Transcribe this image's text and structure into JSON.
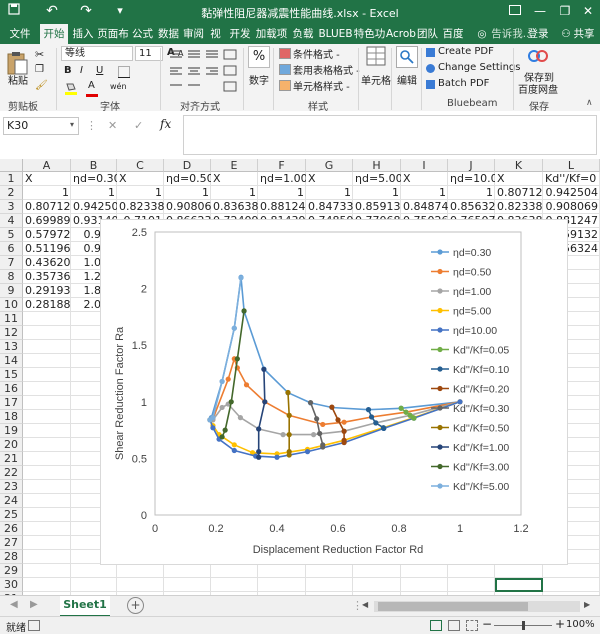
{
  "window": {
    "title": "黏弹性阻尼器减震性能曲线.xlsx - Excel",
    "undo": "↶",
    "redo": "↷",
    "minimize": "—",
    "restore": "❐",
    "close": "✕"
  },
  "tabs": [
    "文件",
    "开始",
    "插入",
    "页面布",
    "公式",
    "数据",
    "审阅",
    "视图",
    "开发工",
    "加载项",
    "负载测",
    "BLUEB",
    "特色功",
    "Acrob",
    "团队",
    "百度网"
  ],
  "tabs_active": "开始",
  "tell_me": "告诉我...",
  "login": "登录",
  "share": "共享",
  "ribbon": {
    "clipboard": {
      "paste": "粘贴",
      "label": "剪贴板"
    },
    "font": {
      "name": "等线",
      "size": "11",
      "label": "字体",
      "bold": "B",
      "italic": "I",
      "underline": "U",
      "grow": "A",
      "shrink": "A",
      "color_a": "A",
      "wen": "wén"
    },
    "align": {
      "label": "对齐方式"
    },
    "number": {
      "label": "数字",
      "pct": "%"
    },
    "styles": {
      "cond": "条件格式 -",
      "table": "套用表格格式 -",
      "cell": "单元格样式 -",
      "label": "样式"
    },
    "cells": {
      "label": "单元格"
    },
    "edit": {
      "label": "编辑"
    },
    "bluebeam": {
      "create": "Create PDF",
      "settings": "Change Settings",
      "batch": "Batch PDF",
      "label": "Bluebeam"
    },
    "save": {
      "line1": "保存到",
      "line2": "百度网盘",
      "label": "保存"
    }
  },
  "formula_bar": {
    "namebox": "K30",
    "fx": "fx",
    "cancel": "✕",
    "enter": "✓",
    "value": ""
  },
  "columns": [
    "A",
    "B",
    "C",
    "D",
    "E",
    "F",
    "G",
    "H",
    "I",
    "J",
    "K",
    "L"
  ],
  "rows": [
    "1",
    "2",
    "3",
    "4",
    "5",
    "6",
    "7",
    "8",
    "9",
    "10",
    "11",
    "12",
    "13",
    "14",
    "15",
    "16",
    "17",
    "18",
    "19",
    "20",
    "21",
    "22",
    "23",
    "24",
    "25",
    "26",
    "27",
    "28",
    "29",
    "30",
    "31"
  ],
  "cells": {
    "r1": [
      "X",
      "ηd=0.30",
      "X",
      "ηd=0.50",
      "X",
      "ηd=1.00",
      "X",
      "ηd=5.00",
      "X",
      "ηd=10.00",
      "X",
      "Kd''/Kf=0"
    ],
    "r2": [
      "1",
      "1",
      "1",
      "1",
      "1",
      "1",
      "1",
      "1",
      "1",
      "1",
      "0.807126",
      "0.942504"
    ],
    "r3": [
      "0.807126",
      "0.942504",
      "0.82338",
      "0.908069",
      "0.836383",
      "0.881247",
      "0.847337",
      "0.859132",
      "0.848742",
      "0.856324",
      "0.82338",
      "0.908069"
    ],
    "r4": [
      "0.699896",
      "0.931406",
      "0.7101",
      "0.866239",
      "0.724093",
      "0.814392",
      "0.74859",
      "0.77068",
      "0.750266",
      "0.765073",
      "0.836383",
      "0.881247"
    ],
    "r5": [
      "0.579725",
      "0.953",
      "",
      "",
      "",
      "",
      "",
      "",
      "",
      "",
      "",
      "0.859132"
    ],
    "r6": [
      "0.511962",
      "0.993",
      "",
      "",
      "",
      "",
      "",
      "",
      "",
      "",
      "",
      "0.856324"
    ],
    "r7": [
      "0.436209",
      "1.082",
      "",
      "",
      "",
      "",
      "",
      "",
      "",
      "",
      "",
      ""
    ],
    "r8": [
      "0.357363",
      "1.287",
      "",
      "",
      "",
      "",
      "",
      "",
      "",
      "",
      "",
      ""
    ],
    "r9": [
      "0.291935",
      "1.803",
      "",
      "",
      "",
      "",
      "",
      "",
      "",
      "",
      "",
      ""
    ],
    "r10": [
      "0.281887",
      "2.095",
      "",
      "",
      "",
      "",
      "",
      "",
      "",
      "",
      "",
      ""
    ]
  },
  "sheet_tab": "Sheet1",
  "add_sheet": "+",
  "status": {
    "ready": "就绪",
    "zoom": "100%",
    "minus": "−",
    "plus": "+"
  },
  "chart_data": {
    "type": "line",
    "xlabel": "Displacement Reduction Factor Rd",
    "ylabel": "Shear Reduction Factor Ra",
    "xlim": [
      0,
      1.2
    ],
    "ylim": [
      0,
      2.5
    ],
    "xticks": [
      "0",
      "0.2",
      "0.4",
      "0.6",
      "0.8",
      "1",
      "1.2"
    ],
    "yticks": [
      "0",
      "0.5",
      "1",
      "1.5",
      "2",
      "2.5"
    ],
    "legend_position": "right",
    "series": [
      {
        "name": "ηd=0.30",
        "color": "#5b9bd5",
        "points": [
          [
            1,
            1
          ],
          [
            0.807,
            0.943
          ],
          [
            0.7,
            0.93
          ],
          [
            0.58,
            0.95
          ],
          [
            0.51,
            0.99
          ],
          [
            0.436,
            1.08
          ],
          [
            0.357,
            1.29
          ],
          [
            0.292,
            1.8
          ],
          [
            0.282,
            2.1
          ],
          [
            0.26,
            1.65
          ],
          [
            0.22,
            1.18
          ],
          [
            0.185,
            0.86
          ]
        ]
      },
      {
        "name": "ηd=0.50",
        "color": "#ed7d31",
        "points": [
          [
            1,
            1
          ],
          [
            0.823,
            0.908
          ],
          [
            0.71,
            0.866
          ],
          [
            0.62,
            0.82
          ],
          [
            0.55,
            0.8
          ],
          [
            0.44,
            0.88
          ],
          [
            0.36,
            1.0
          ],
          [
            0.3,
            1.15
          ],
          [
            0.27,
            1.3
          ],
          [
            0.26,
            1.38
          ],
          [
            0.24,
            1.2
          ],
          [
            0.19,
            0.85
          ]
        ]
      },
      {
        "name": "ηd=1.00",
        "color": "#a5a5a5",
        "points": [
          [
            1,
            1
          ],
          [
            0.836,
            0.881
          ],
          [
            0.724,
            0.814
          ],
          [
            0.62,
            0.74
          ],
          [
            0.52,
            0.71
          ],
          [
            0.42,
            0.71
          ],
          [
            0.34,
            0.76
          ],
          [
            0.28,
            0.86
          ],
          [
            0.24,
            0.98
          ],
          [
            0.22,
            0.95
          ],
          [
            0.19,
            0.84
          ]
        ]
      },
      {
        "name": "ηd=5.00",
        "color": "#ffc000",
        "points": [
          [
            1,
            1
          ],
          [
            0.847,
            0.859
          ],
          [
            0.749,
            0.771
          ],
          [
            0.62,
            0.66
          ],
          [
            0.5,
            0.58
          ],
          [
            0.4,
            0.54
          ],
          [
            0.32,
            0.55
          ],
          [
            0.26,
            0.62
          ],
          [
            0.21,
            0.71
          ],
          [
            0.19,
            0.79
          ],
          [
            0.18,
            0.84
          ]
        ]
      },
      {
        "name": "ηd=10.00",
        "color": "#4472c4",
        "points": [
          [
            1,
            1
          ],
          [
            0.849,
            0.856
          ],
          [
            0.75,
            0.765
          ],
          [
            0.62,
            0.64
          ],
          [
            0.5,
            0.56
          ],
          [
            0.4,
            0.51
          ],
          [
            0.33,
            0.52
          ],
          [
            0.26,
            0.57
          ],
          [
            0.21,
            0.67
          ],
          [
            0.19,
            0.77
          ],
          [
            0.18,
            0.84
          ]
        ]
      },
      {
        "name": "Kd''/Kf=0.05",
        "color": "#70ad47",
        "points": [
          [
            0.807,
            0.943
          ],
          [
            0.823,
            0.908
          ],
          [
            0.836,
            0.881
          ],
          [
            0.847,
            0.859
          ],
          [
            0.849,
            0.856
          ]
        ]
      },
      {
        "name": "Kd''/Kf=0.10",
        "color": "#255e91",
        "points": [
          [
            0.7,
            0.931
          ],
          [
            0.71,
            0.866
          ],
          [
            0.724,
            0.814
          ],
          [
            0.749,
            0.771
          ],
          [
            0.75,
            0.765
          ]
        ]
      },
      {
        "name": "Kd''/Kf=0.20",
        "color": "#9e480e",
        "points": [
          [
            0.58,
            0.953
          ],
          [
            0.6,
            0.84
          ],
          [
            0.62,
            0.74
          ],
          [
            0.62,
            0.66
          ],
          [
            0.62,
            0.64
          ]
        ]
      },
      {
        "name": "Kd''/Kf=0.30",
        "color": "#636363",
        "points": [
          [
            0.51,
            0.993
          ],
          [
            0.53,
            0.85
          ],
          [
            0.54,
            0.72
          ],
          [
            0.55,
            0.62
          ],
          [
            0.55,
            0.6
          ]
        ]
      },
      {
        "name": "Kd''/Kf=0.50",
        "color": "#997300",
        "points": [
          [
            0.436,
            1.082
          ],
          [
            0.44,
            0.88
          ],
          [
            0.44,
            0.71
          ],
          [
            0.44,
            0.56
          ],
          [
            0.44,
            0.53
          ]
        ]
      },
      {
        "name": "Kd''/Kf=1.00",
        "color": "#264478",
        "points": [
          [
            0.357,
            1.287
          ],
          [
            0.36,
            1.0
          ],
          [
            0.34,
            0.76
          ],
          [
            0.34,
            0.56
          ],
          [
            0.34,
            0.51
          ]
        ]
      },
      {
        "name": "Kd''/Kf=3.00",
        "color": "#43682b",
        "points": [
          [
            0.292,
            1.803
          ],
          [
            0.27,
            1.38
          ],
          [
            0.25,
            1.0
          ],
          [
            0.23,
            0.75
          ],
          [
            0.22,
            0.69
          ]
        ]
      },
      {
        "name": "Kd''/Kf=5.00",
        "color": "#7cafdd",
        "points": [
          [
            0.282,
            2.095
          ],
          [
            0.26,
            1.65
          ],
          [
            0.22,
            1.18
          ],
          [
            0.19,
            0.86
          ],
          [
            0.18,
            0.84
          ]
        ]
      }
    ]
  }
}
